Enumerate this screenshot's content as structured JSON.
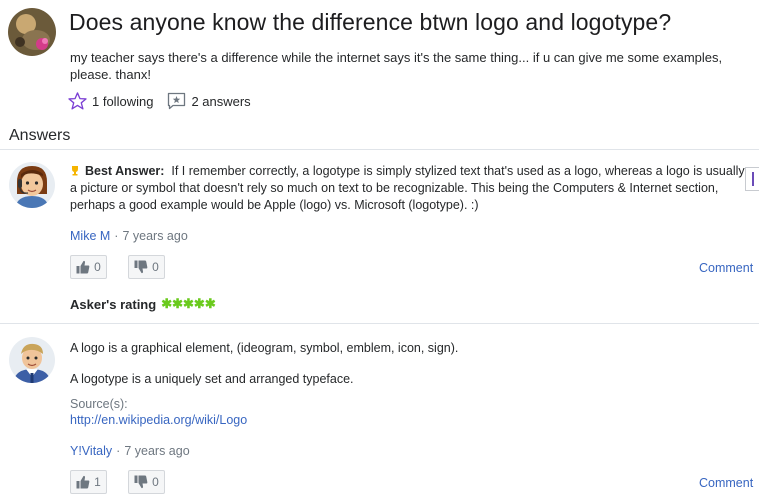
{
  "question": {
    "title": "Does anyone know the difference btwn logo and logotype?",
    "body": "my teacher says there's a difference while the internet says it's the same thing... if u can give me some examples, please. thanx!",
    "following": "1 following",
    "answers_count": "2 answers"
  },
  "answers_heading": "Answers",
  "best_answer": {
    "label": "Best Answer:",
    "text": "If I remember correctly, a logotype is simply stylized text that's used as a logo, whereas a logo is usually a picture or symbol that doesn't rely so much on text to be recognizable. This being the Computers & Internet section, perhaps a good example would be Apple (logo) vs. Microsoft (logotype). :)",
    "author": "Mike M",
    "time": "7 years ago",
    "thumbs_up": "0",
    "thumbs_down": "0",
    "comment": "Comment",
    "asker_rating_label": "Asker's rating",
    "asker_rating": 5
  },
  "answer2": {
    "paragraph1": "A logo is a graphical element, (ideogram, symbol, emblem, icon, sign).",
    "paragraph2": "A logotype is a uniquely set and arranged typeface.",
    "source_label": "Source(s):",
    "source_link": "http://en.wikipedia.org/wiki/Logo",
    "author": "Y!Vitaly",
    "time": "7 years ago",
    "thumbs_up": "1",
    "thumbs_down": "0",
    "comment": "Comment"
  },
  "colors": {
    "link": "#3866c1",
    "purple_icon": "#7b3fd4",
    "star_green": "#6aca1d",
    "trophy": "#f5b400"
  }
}
